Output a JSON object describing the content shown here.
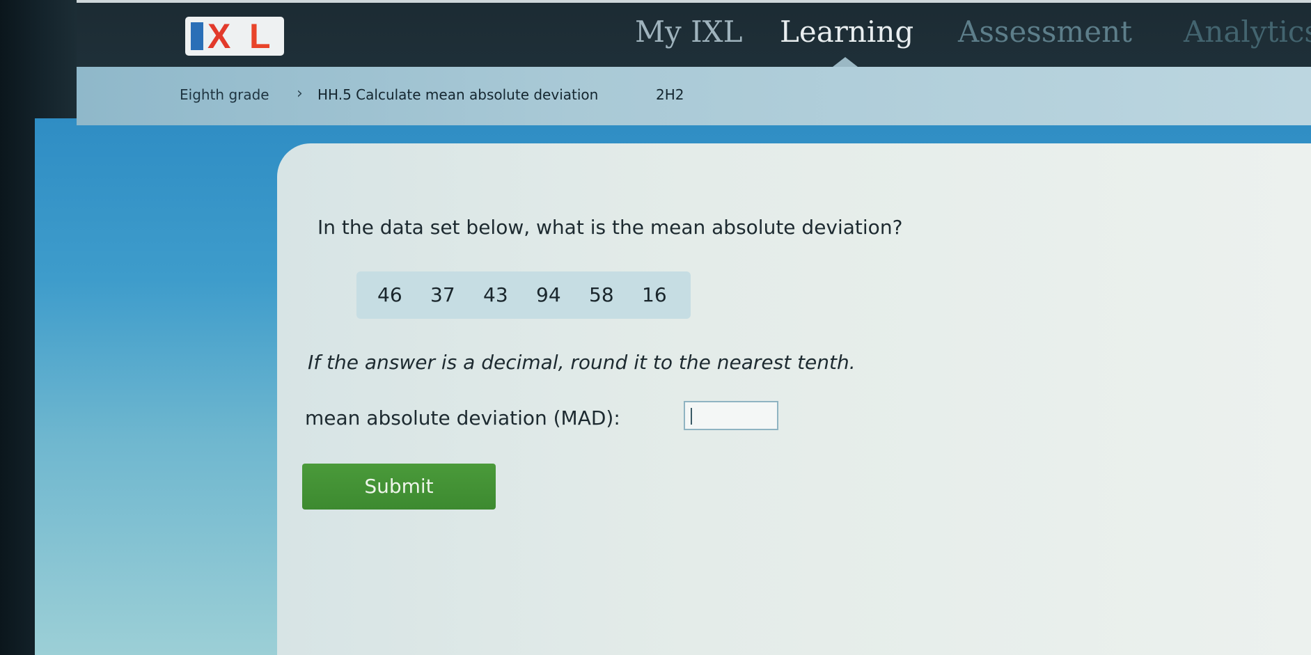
{
  "nav": {
    "logo_text": "IXL",
    "items": [
      {
        "label": "My IXL"
      },
      {
        "label": "Learning"
      },
      {
        "label": "Assessment"
      },
      {
        "label": "Analytics"
      }
    ],
    "active_item": "Learning"
  },
  "breadcrumb": {
    "grade": "Eighth grade",
    "separator": "›",
    "skill": "HH.5 Calculate mean absolute deviation",
    "code": "2H2"
  },
  "question": {
    "prompt": "In the data set below, what is the mean absolute deviation?",
    "dataset": [
      "46",
      "37",
      "43",
      "94",
      "58",
      "16"
    ],
    "hint": "If the answer is a decimal, round it to the nearest tenth.",
    "answer_label": "mean absolute deviation (MAD):",
    "answer_value": "",
    "submit_label": "Submit"
  },
  "colors": {
    "nav_bg": "#1c2b33",
    "breadcrumb_bg": "#a9c9d6",
    "page_bg": "#3e9ccb",
    "card_bg": "#e4ece9",
    "dataset_bg": "#c6dde3",
    "submit_bg": "#3d8a30",
    "logo_blue": "#2a6fb7",
    "logo_red": "#e23a2b"
  }
}
